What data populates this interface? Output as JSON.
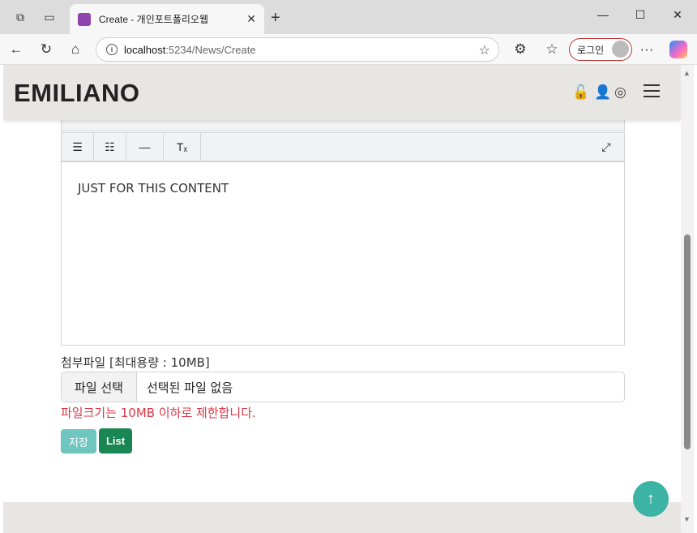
{
  "browser": {
    "tab_title": "Create - 개인포트폴리오웹",
    "url_host": "localhost",
    "url_path": ":5234/News/Create",
    "login_label": "로그인",
    "new_tab": "+",
    "more": "···"
  },
  "site": {
    "logo": "EMILIANO"
  },
  "editor": {
    "content": "JUST FOR THIS CONTENT",
    "toolbar_row2": [
      {
        "name": "bullet-list-icon",
        "glyph": "☰"
      },
      {
        "name": "numbered-list-icon",
        "glyph": "☷"
      },
      {
        "name": "horizontal-rule-icon",
        "glyph": "—"
      },
      {
        "name": "clear-format-icon",
        "glyph": "Tₓ"
      }
    ],
    "fullscreen_glyph": "⤢"
  },
  "file": {
    "label": "첨부파일 [최대용량 : 10MB]",
    "button": "파일 선택",
    "status": "선택된 파일 없음",
    "warning": "파일크기는 10MB 이하로 제한합니다."
  },
  "actions": {
    "save": "저장",
    "list": "List"
  },
  "colors": {
    "save_button": "#6fc5bf",
    "list_button": "#198754",
    "warning": "#dc3545",
    "scroll_top": "#3bb3a5"
  }
}
